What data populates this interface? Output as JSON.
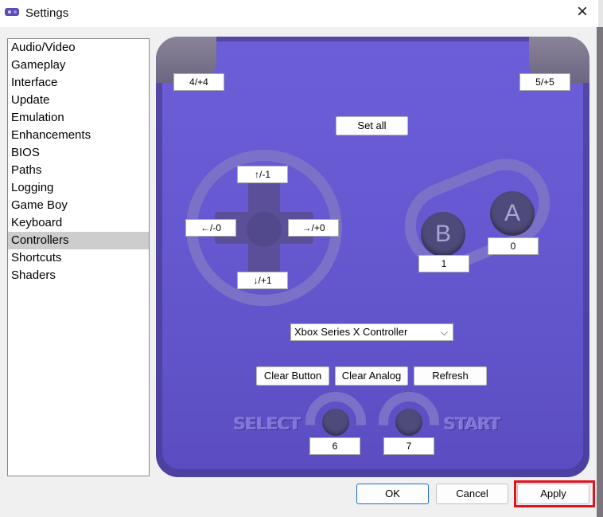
{
  "window": {
    "title": "Settings",
    "close_icon": "close-icon"
  },
  "sidebar": {
    "items": [
      {
        "label": "Audio/Video"
      },
      {
        "label": "Gameplay"
      },
      {
        "label": "Interface"
      },
      {
        "label": "Update"
      },
      {
        "label": "Emulation"
      },
      {
        "label": "Enhancements"
      },
      {
        "label": "BIOS"
      },
      {
        "label": "Paths"
      },
      {
        "label": "Logging"
      },
      {
        "label": "Game Boy"
      },
      {
        "label": "Keyboard"
      },
      {
        "label": "Controllers"
      },
      {
        "label": "Shortcuts"
      },
      {
        "label": "Shaders"
      }
    ],
    "selected": "Controllers"
  },
  "controller": {
    "l_binding": "4/+4",
    "r_binding": "5/+5",
    "set_all_label": "Set all",
    "dpad": {
      "up": "↑/-1",
      "left": "←/-0",
      "right": "→/+0",
      "down": "↓/+1"
    },
    "b_glyph": "B",
    "a_glyph": "A",
    "b_binding": "1",
    "a_binding": "0",
    "device": "Xbox Series X Controller",
    "clear_button_label": "Clear Button",
    "clear_analog_label": "Clear Analog",
    "refresh_label": "Refresh",
    "select_label": "SELECT",
    "start_label": "START",
    "select_binding": "6",
    "start_binding": "7"
  },
  "footer": {
    "ok_label": "OK",
    "cancel_label": "Cancel",
    "apply_label": "Apply"
  },
  "colors": {
    "panel": "#6658d0",
    "highlight": "#e0141e",
    "selected_item": "#cdcdcd"
  }
}
